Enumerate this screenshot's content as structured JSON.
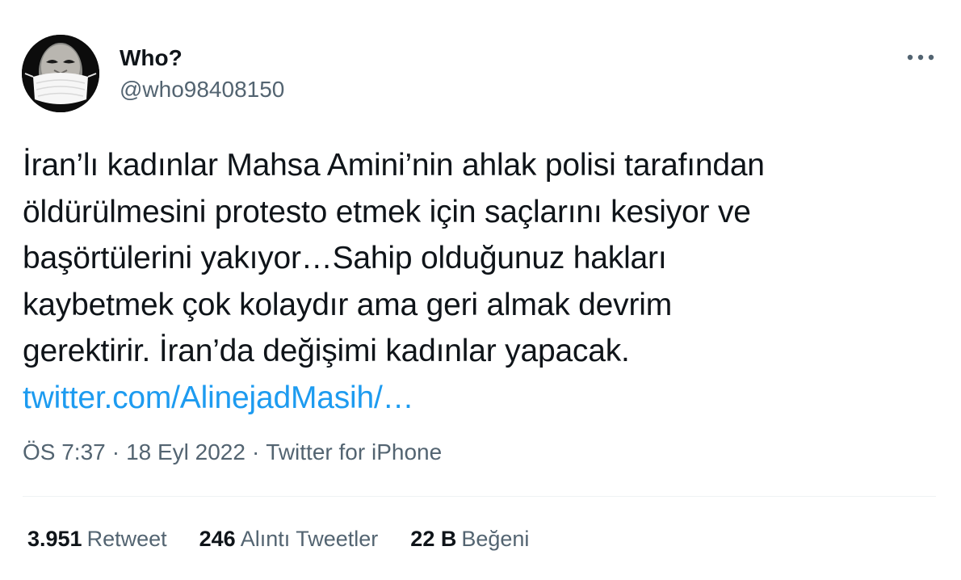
{
  "author": {
    "display_name": "Who?",
    "handle": "@who98408150"
  },
  "tweet": {
    "text_lines": [
      "İran’lı kadınlar Mahsa Amini’nin ahlak polisi tarafından",
      "öldürülmesini protesto etmek için saçlarını kesiyor ve",
      "başörtülerini yakıyor…Sahip olduğunuz hakları",
      "kaybetmek çok kolaydır ama geri almak devrim",
      "gerektirir. İran’da değişimi kadınlar yapacak."
    ],
    "link_text": "twitter.com/AlinejadMasih/…"
  },
  "meta": {
    "time": "ÖS 7:37",
    "separator": "·",
    "date": "18 Eyl 2022",
    "source": "Twitter for iPhone"
  },
  "stats": {
    "retweets": {
      "count": "3.951",
      "label": "Retweet"
    },
    "quotes": {
      "count": "246",
      "label": "Alıntı Tweetler"
    },
    "likes": {
      "count": "22 B",
      "label": "Beğeni"
    }
  },
  "icons": {
    "more": "more-horizontal-icon",
    "avatar": "masked-face-avatar"
  },
  "colors": {
    "link": "#1d9bf0",
    "primary_text": "#0f1419",
    "secondary_text": "#536471",
    "divider": "#eff3f4"
  }
}
